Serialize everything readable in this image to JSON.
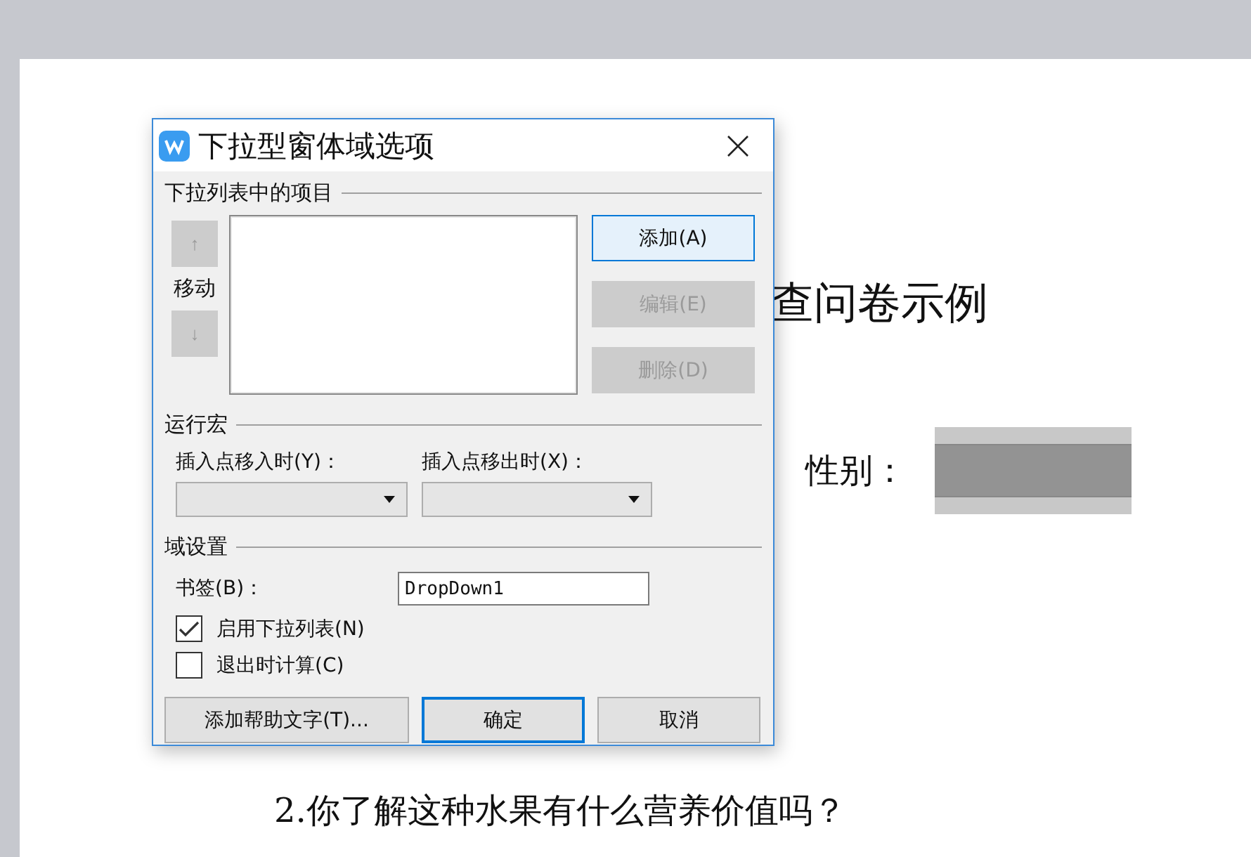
{
  "document": {
    "title": "查问卷示例",
    "gender_label": "性别：",
    "question": "2.你了解这种水果有什么营养价值吗？"
  },
  "dialog": {
    "title": "下拉型窗体域选项",
    "items_section": {
      "heading": "下拉列表中的项目",
      "move_label": "移动",
      "move_buttons": [
        {
          "label": "↑",
          "disabled": true
        },
        {
          "label": "↓",
          "disabled": true
        }
      ],
      "actions": [
        {
          "label": "添加(A)",
          "disabled": false,
          "highlighted": true
        },
        {
          "label": "编辑(E)",
          "disabled": true,
          "highlighted": false
        },
        {
          "label": "删除(D)",
          "disabled": true,
          "highlighted": false
        }
      ]
    },
    "macro_section": {
      "heading": "运行宏",
      "fields": [
        {
          "label": "插入点移入时(Y)："
        },
        {
          "label": "插入点移出时(X)："
        }
      ]
    },
    "field_section": {
      "heading": "域设置",
      "bookmark_label": "书签(B)：",
      "bookmark_value": "DropDown1",
      "checkboxes": [
        {
          "label": "启用下拉列表(N)",
          "checked": true
        },
        {
          "label": "退出时计算(C)",
          "checked": false
        }
      ]
    },
    "buttons": [
      {
        "label": "添加帮助文字(T)...",
        "default": false
      },
      {
        "label": "确定",
        "default": true
      },
      {
        "label": "取消",
        "default": false
      }
    ]
  }
}
